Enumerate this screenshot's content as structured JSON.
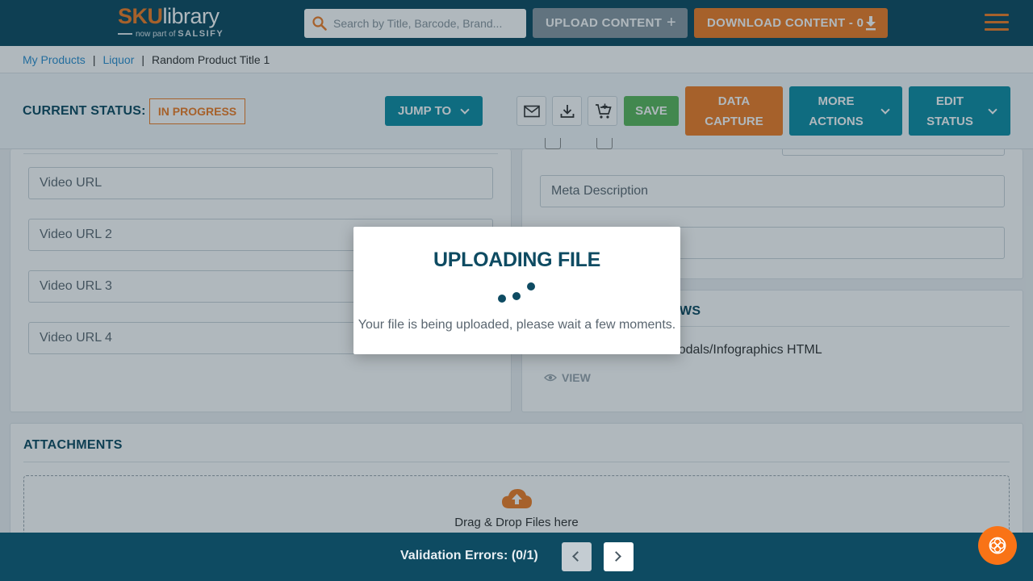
{
  "header": {
    "logo": {
      "sku": "SKU",
      "library": "library",
      "sub_prefix": "now part of",
      "sub_brand": "SALSIFY"
    },
    "search_placeholder": "Search by Title, Barcode, Brand...",
    "upload_label": "UPLOAD CONTENT",
    "download_label": "DOWNLOAD CONTENT - 0"
  },
  "breadcrumb": {
    "items": [
      "My Products",
      "Liquor"
    ],
    "separator": "|",
    "current": "Random Product Title 1"
  },
  "status_bar": {
    "label": "CURRENT STATUS:",
    "status": "IN PROGRESS",
    "jump_to": "JUMP TO",
    "save": "SAVE",
    "data_capture_line1": "DATA",
    "data_capture_line2": "CAPTURE",
    "more_actions_line1": "MORE",
    "more_actions_line2": "ACTIONS",
    "edit_status_line1": "EDIT",
    "edit_status_line2": "STATUS"
  },
  "video_fields": {
    "url1_placeholder": "Video URL",
    "url2_placeholder": "Video URL 2",
    "url3_placeholder": "Video URL 3",
    "url4_placeholder": "Video URL 4"
  },
  "seo_fields": {
    "meta_description_placeholder": "Meta Description"
  },
  "rich_content": {
    "title_visible": "WS",
    "item_label": "Generic Rich Content Modals/Infographics HTML",
    "view_label": "VIEW"
  },
  "attachments": {
    "title": "ATTACHMENTS",
    "dropzone_text": "Drag & Drop Files here"
  },
  "footer": {
    "validation_text": "Validation Errors: (0/1)"
  },
  "modal": {
    "title": "UPLOADING FILE",
    "message": "Your file is being uploaded, please wait a few moments."
  },
  "colors": {
    "brand_dark": "#0e4b62",
    "brand_teal": "#0f8ea5",
    "brand_orange": "#f07e26",
    "save_green": "#5cb85c",
    "link_blue": "#2d8fd0"
  },
  "icons": [
    "search-icon",
    "plus-icon",
    "download-icon",
    "hamburger-icon",
    "chevron-down-icon",
    "email-icon",
    "cart-add-icon",
    "cloud-upload-icon",
    "eye-icon",
    "chevron-left-icon",
    "chevron-right-icon",
    "help-icon"
  ]
}
